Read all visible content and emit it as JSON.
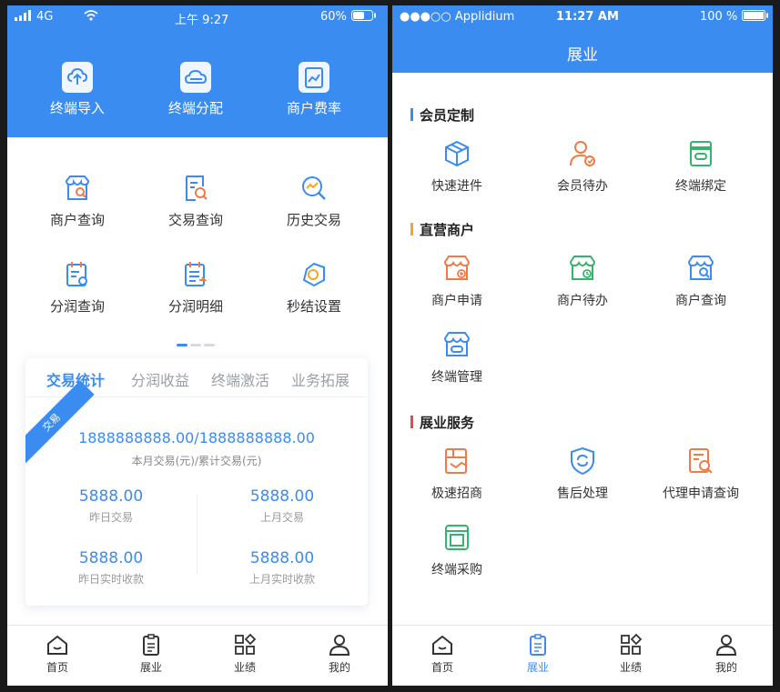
{
  "left": {
    "status": {
      "signal": "4G",
      "time": "上午 9:27",
      "battery": "60%"
    },
    "top_actions": [
      {
        "label": "终端导入",
        "icon": "cloud-upload-icon"
      },
      {
        "label": "终端分配",
        "icon": "cloud-share-icon"
      },
      {
        "label": "商户费率",
        "icon": "rate-chart-icon"
      }
    ],
    "grid": [
      {
        "label": "商户查询",
        "icon": "shop-search-icon"
      },
      {
        "label": "交易查询",
        "icon": "receipt-search-icon"
      },
      {
        "label": "历史交易",
        "icon": "history-search-icon"
      },
      {
        "label": "分润查询",
        "icon": "calendar-search-icon"
      },
      {
        "label": "分润明细",
        "icon": "calendar-list-icon"
      },
      {
        "label": "秒结设置",
        "icon": "settle-cube-icon"
      }
    ],
    "page_indicator": {
      "current": 1,
      "total": 3
    },
    "stats": {
      "tabs": [
        "交易统计",
        "分润收益",
        "终端激活",
        "业务拓展"
      ],
      "active_tab": 0,
      "ribbon": "交易",
      "total_value": "1888888888.00/1888888888.00",
      "total_label": "本月交易(元)/累计交易(元)",
      "cells": [
        {
          "value": "5888.00",
          "label": "昨日交易"
        },
        {
          "value": "5888.00",
          "label": "上月交易"
        },
        {
          "value": "5888.00",
          "label": "昨日实时收款"
        },
        {
          "value": "5888.00",
          "label": "上月实时收款"
        }
      ]
    },
    "tabbar": [
      {
        "label": "首页",
        "icon": "home-icon"
      },
      {
        "label": "展业",
        "icon": "clipboard-icon"
      },
      {
        "label": "业绩",
        "icon": "apps-icon"
      },
      {
        "label": "我的",
        "icon": "user-icon"
      }
    ]
  },
  "right": {
    "status": {
      "carrier": "●●●○○ Applidium",
      "time": "11:27 AM",
      "battery": "100 %"
    },
    "title": "展业",
    "sections": [
      {
        "title": "会员定制",
        "color": "#3a8cf1",
        "items": [
          {
            "label": "快速进件",
            "icon": "package-icon",
            "color": "#3a8cf1"
          },
          {
            "label": "会员待办",
            "icon": "member-todo-icon",
            "color": "#f07a45"
          },
          {
            "label": "终端绑定",
            "icon": "terminal-bind-icon",
            "color": "#35b46e"
          }
        ]
      },
      {
        "title": "直营商户",
        "color": "#f5a623",
        "items": [
          {
            "label": "商户申请",
            "icon": "shop-apply-icon",
            "color": "#f07a45"
          },
          {
            "label": "商户待办",
            "icon": "shop-todo-icon",
            "color": "#35b46e"
          },
          {
            "label": "商户查询",
            "icon": "shop-search-icon",
            "color": "#3a8cf1"
          },
          {
            "label": "终端管理",
            "icon": "terminal-manage-icon",
            "color": "#3a8cf1"
          }
        ]
      },
      {
        "title": "展业服务",
        "color": "#e94b4b",
        "items": [
          {
            "label": "极速招商",
            "icon": "recruit-icon",
            "color": "#f07a45"
          },
          {
            "label": "售后处理",
            "icon": "after-sale-shield-icon",
            "color": "#3a8cf1"
          },
          {
            "label": "代理申请查询",
            "icon": "agent-query-icon",
            "color": "#f07a45"
          },
          {
            "label": "终端采购",
            "icon": "terminal-purchase-icon",
            "color": "#35b46e"
          }
        ]
      }
    ],
    "tabbar": [
      {
        "label": "首页",
        "icon": "home-icon"
      },
      {
        "label": "展业",
        "icon": "clipboard-icon"
      },
      {
        "label": "业绩",
        "icon": "apps-icon"
      },
      {
        "label": "我的",
        "icon": "user-icon"
      }
    ],
    "tabbar_active": 1
  }
}
